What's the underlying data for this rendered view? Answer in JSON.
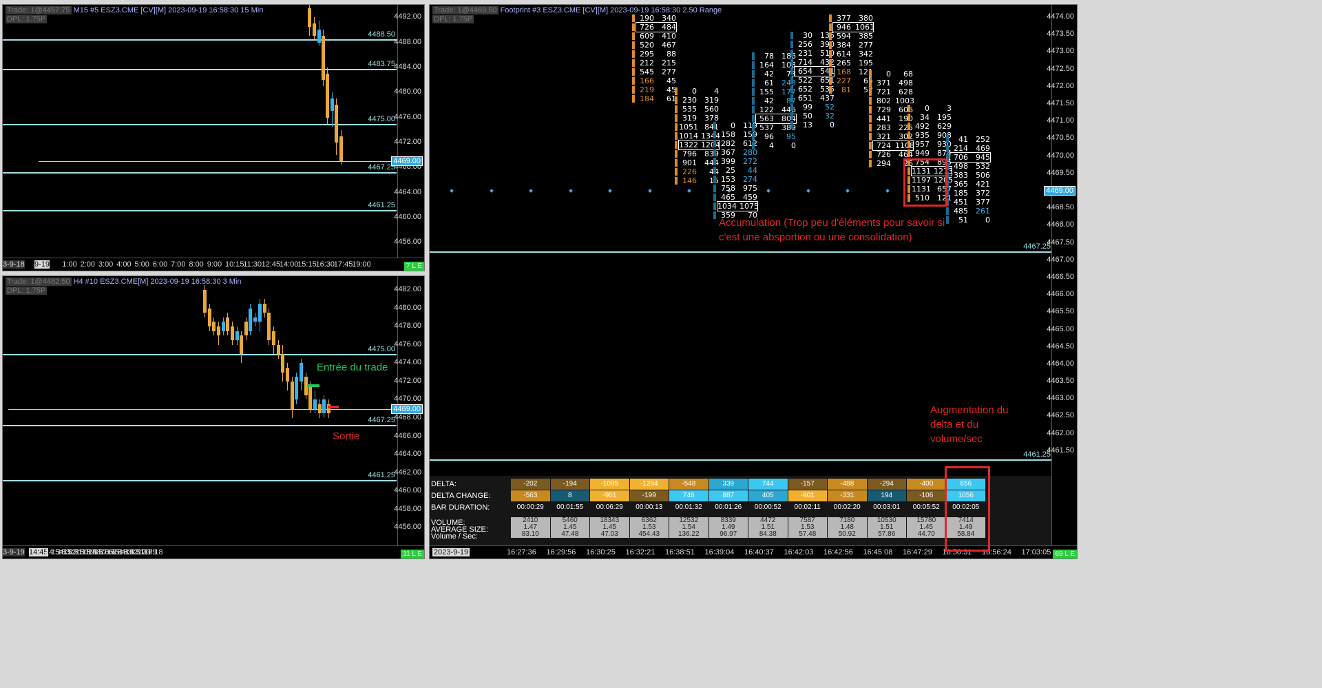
{
  "chart_m15": {
    "header_trade": "Trade: 1@4457.75",
    "header_title": "M15 #5 ESZ3.CME [CV][M] 2023-09-19 16:58:30 15 Min",
    "dpl": "DPL: 1.75P",
    "price_ticks": [
      "4492.00",
      "4488.00",
      "4484.00",
      "4480.00",
      "4476.00",
      "4472.00",
      "4468.00",
      "4464.00",
      "4460.00",
      "4456.00"
    ],
    "levels": [
      "4488.50",
      "4483.75",
      "4475.00",
      "4467.25",
      "4461.25"
    ],
    "current_price": "4469.00",
    "time_labels": [
      "3-9-18",
      "9-19",
      "1:00",
      "2:00",
      "3:00",
      "4:00",
      "5:00",
      "6:00",
      "7:00",
      "8:00",
      "9:00",
      "10:15",
      "11:30",
      "12:45",
      "14:00",
      "15:15",
      "16:30",
      "17:45",
      "19:00"
    ],
    "badge": "7 L E"
  },
  "chart_h4": {
    "header_trade": "Trade: 1@4482.50",
    "header_title": "H4 #10 ESZ3.CME[M] 2023-09-19 16:58:30 3 Min",
    "dpl": "DPL: 1.75P",
    "price_ticks": [
      "4482.00",
      "4480.00",
      "4478.00",
      "4476.00",
      "4474.00",
      "4472.00",
      "4470.00",
      "4468.00",
      "4466.00",
      "4464.00",
      "4462.00",
      "4460.00",
      "4458.00",
      "4456.00"
    ],
    "levels": [
      "4475.00",
      "4467.25",
      "4461.25"
    ],
    "current_price": "4469.00",
    "time_labels": [
      "3-9-19",
      "14:45",
      "14:54",
      "15:03",
      "15:12",
      "15:21",
      "15:30",
      "15:39",
      "15:48",
      "15:57",
      "16:06",
      "16:15",
      "16:24",
      "16:33",
      "16:42",
      "16:51",
      "17:00",
      "17:09",
      "17:18"
    ],
    "badge": "11 L E",
    "annotation_entry": "Entrée du trade",
    "annotation_exit": "Sortie"
  },
  "footprint": {
    "header_trade": "Trade: 1@4469.50",
    "header_title": "Footprint #3 ESZ3.CME [CV][M] 2023-09-19 16:58:30 2.50 Range",
    "dpl": "DPL: 1.75P",
    "price_ticks": [
      "4474.00",
      "4473.50",
      "4473.00",
      "4472.50",
      "4472.00",
      "4471.50",
      "4471.00",
      "4470.50",
      "4470.00",
      "4469.50",
      "4469.00",
      "4468.50",
      "4468.00",
      "4467.50",
      "4467.00",
      "4466.50",
      "4466.00",
      "4465.50",
      "4465.00",
      "4464.50",
      "4464.00",
      "4463.50",
      "4463.00",
      "4462.50",
      "4462.00",
      "4461.50"
    ],
    "levels": [
      "4467.25",
      "4461.25"
    ],
    "current_price": "4469.00",
    "annotation_accumulation": "Accumulation (Trop peu d'éléments pour savoir si c'est une absportion ou une consolidation)",
    "annotation_delta": "Augmentation du delta et du volume/sec",
    "columns": [
      {
        "rows": [
          [
            "190",
            "340"
          ],
          [
            "726",
            "484"
          ],
          [
            "609",
            "410"
          ],
          [
            "520",
            "467"
          ],
          [
            "295",
            "88"
          ],
          [
            "212",
            "215"
          ],
          [
            "545",
            "277"
          ],
          [
            "166",
            "45"
          ],
          [
            "219",
            "45"
          ],
          [
            "184",
            "61"
          ]
        ]
      },
      {
        "rows": [
          [
            "0",
            "4"
          ],
          [
            "230",
            "319"
          ],
          [
            "535",
            "560"
          ],
          [
            "319",
            "378"
          ],
          [
            "1051",
            "841"
          ],
          [
            "1014",
            "1344"
          ],
          [
            "1322",
            "1204"
          ],
          [
            "796",
            "839"
          ],
          [
            "901",
            "444"
          ],
          [
            "226",
            "44"
          ],
          [
            "146",
            "15"
          ]
        ]
      },
      {
        "rows": [
          [
            "0",
            "119"
          ],
          [
            "158",
            "159"
          ],
          [
            "282",
            "612"
          ],
          [
            "367",
            "280"
          ],
          [
            "399",
            "272"
          ],
          [
            "25",
            "44"
          ],
          [
            "153",
            "274"
          ],
          [
            "758",
            "975"
          ],
          [
            "465",
            "459"
          ],
          [
            "1034",
            "1075"
          ],
          [
            "359",
            "70"
          ]
        ]
      },
      {
        "rows": [
          [
            "78",
            "186"
          ],
          [
            "164",
            "108"
          ],
          [
            "42",
            "73"
          ],
          [
            "61",
            "243"
          ],
          [
            "155",
            "177"
          ],
          [
            "42",
            "87"
          ],
          [
            "122",
            "446"
          ],
          [
            "563",
            "804"
          ],
          [
            "537",
            "389"
          ],
          [
            "96",
            "95"
          ],
          [
            "4",
            "0"
          ]
        ]
      },
      {
        "rows": [
          [
            "30",
            "135"
          ],
          [
            "256",
            "390"
          ],
          [
            "231",
            "510"
          ],
          [
            "714",
            "432"
          ],
          [
            "654",
            "541"
          ],
          [
            "522",
            "651"
          ],
          [
            "652",
            "535"
          ],
          [
            "651",
            "437"
          ],
          [
            "99",
            "52"
          ],
          [
            "50",
            "32"
          ],
          [
            "13",
            "0"
          ]
        ]
      },
      {
        "rows": [
          [
            "377",
            "380"
          ],
          [
            "946",
            "1061"
          ],
          [
            "594",
            "385"
          ],
          [
            "384",
            "277"
          ],
          [
            "614",
            "342"
          ],
          [
            "265",
            "195"
          ],
          [
            "168",
            "121"
          ],
          [
            "227",
            "65"
          ],
          [
            "81",
            "52"
          ]
        ]
      },
      {
        "rows": [
          [
            "0",
            "68"
          ],
          [
            "371",
            "498"
          ],
          [
            "721",
            "628"
          ],
          [
            "802",
            "1003"
          ],
          [
            "729",
            "606"
          ],
          [
            "441",
            "190"
          ],
          [
            "283",
            "225"
          ],
          [
            "321",
            "302"
          ],
          [
            "724",
            "1108"
          ],
          [
            "726",
            "464"
          ],
          [
            "294",
            "26"
          ]
        ]
      },
      {
        "rows": [
          [
            "0",
            "3"
          ],
          [
            "34",
            "195"
          ],
          [
            "492",
            "629"
          ],
          [
            "935",
            "908"
          ],
          [
            "957",
            "930"
          ],
          [
            "949",
            "874"
          ],
          [
            "754",
            "895"
          ],
          [
            "1131",
            "1273"
          ],
          [
            "1197",
            "1205"
          ],
          [
            "1131",
            "657"
          ],
          [
            "510",
            "121"
          ]
        ]
      },
      {
        "rows": [
          [
            "41",
            "252"
          ],
          [
            "214",
            "469"
          ],
          [
            "706",
            "945"
          ],
          [
            "498",
            "532"
          ],
          [
            "383",
            "506"
          ],
          [
            "365",
            "421"
          ],
          [
            "185",
            "372"
          ],
          [
            "451",
            "377"
          ],
          [
            "485",
            "261"
          ],
          [
            "51",
            "0"
          ]
        ]
      }
    ],
    "stats": {
      "labels": {
        "delta": "DELTA:",
        "delta_change": "DELTA CHANGE:",
        "bar_duration": "BAR DURATION:",
        "volume": "VOLUME:",
        "average_size": "AVERAGE SIZE:",
        "volume_sec": "Volume / Sec:"
      },
      "delta": [
        "-202",
        "-194",
        "-1095",
        "-1294",
        "-548",
        "339",
        "744",
        "-157",
        "-488",
        "-294",
        "-400",
        "656"
      ],
      "delta_change": [
        "-563",
        "8",
        "-901",
        "-199",
        "746",
        "887",
        "405",
        "-901",
        "-331",
        "194",
        "-106",
        "1056"
      ],
      "bar_duration": [
        "00:00:29",
        "00:01:55",
        "00:06:29",
        "00:00:13",
        "00:01:32",
        "00:01:26",
        "00:00:52",
        "00:02:11",
        "00:02:20",
        "00:03:01",
        "00:05:52",
        "00:02:05"
      ],
      "volume": [
        "2410",
        "5460",
        "18343",
        "6362",
        "12532",
        "8339",
        "4472",
        "7587",
        "7180",
        "10530",
        "15780",
        "7414"
      ],
      "average_size": [
        "1.47",
        "1.45",
        "1.45",
        "1.53",
        "1.54",
        "1.49",
        "1.51",
        "1.53",
        "1.48",
        "1.51",
        "1.45",
        "1.49"
      ],
      "volume_sec": [
        "83.10",
        "47.48",
        "47.03",
        "454.43",
        "136.22",
        "96.97",
        "84.38",
        "57.48",
        "50.92",
        "57.86",
        "44.70",
        "58.84"
      ]
    },
    "time_labels": [
      "2023-9-19",
      "16:27:36",
      "16:29:56",
      "16:30:25",
      "16:32:21",
      "16:38:51",
      "16:39:04",
      "16:40:37",
      "16:42:03",
      "16:42:56",
      "16:45:08",
      "16:47:29",
      "16:50:31",
      "16:56:24",
      "17:03:05"
    ],
    "badge": "69 L E"
  },
  "colors": {
    "level_line": "#9fe0e6",
    "bull": "#3ab0e8",
    "bear": "#e8a93a",
    "annotation_red": "#e3262a",
    "annotation_green": "#22c55e",
    "delta_pos": "#3cc8f0",
    "delta_neg": "#f0b030"
  }
}
